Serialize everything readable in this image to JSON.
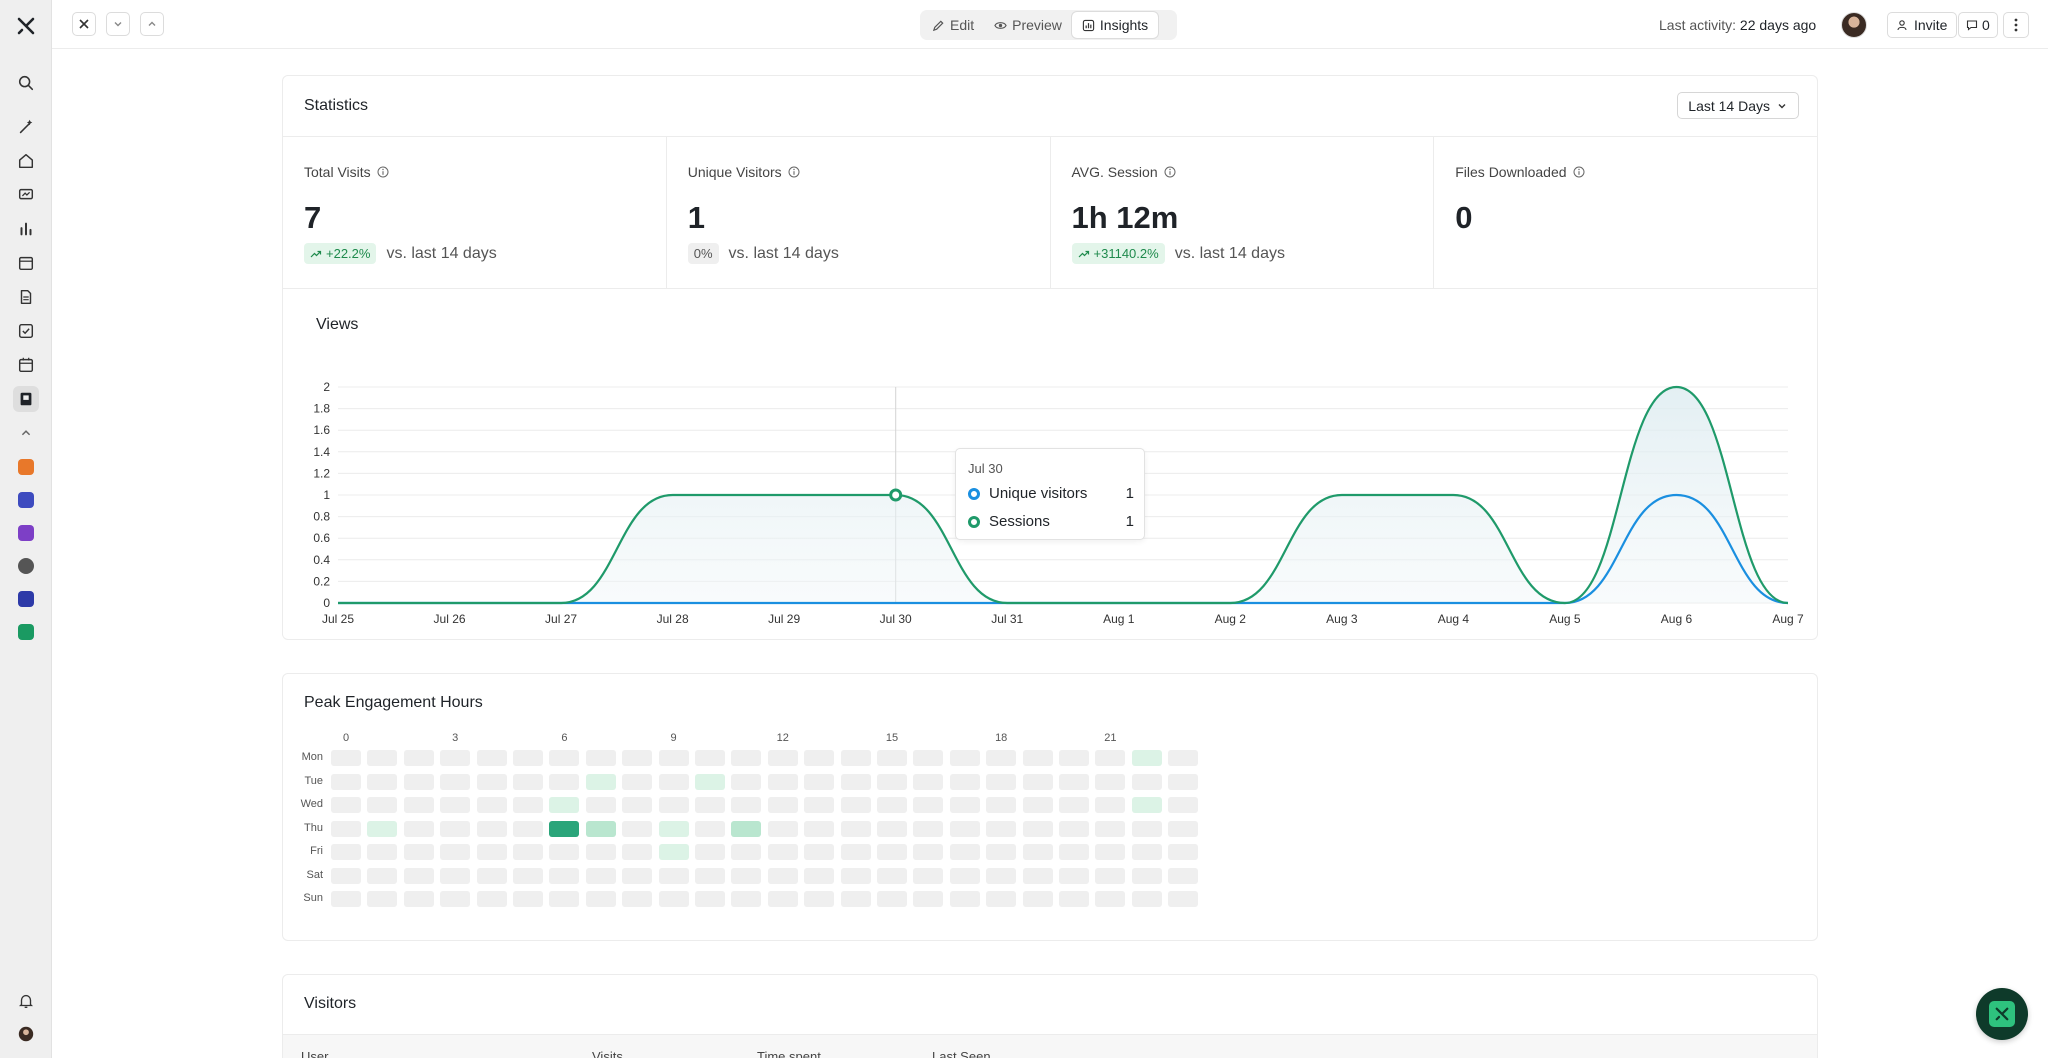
{
  "topbar": {
    "tabs": [
      {
        "label": "Edit",
        "icon": "pencil-icon"
      },
      {
        "label": "Preview",
        "icon": "eye-icon"
      },
      {
        "label": "Insights",
        "icon": "chart-icon",
        "active": true
      }
    ],
    "last_activity_label": "Last activity:",
    "last_activity_value": "22 days ago",
    "invite_label": "Invite",
    "comment_count": "0"
  },
  "statistics": {
    "title": "Statistics",
    "range_label": "Last 14 Days",
    "kpis": [
      {
        "label": "Total Visits",
        "value": "7",
        "change": "+22.2%",
        "trend": "up",
        "compare": "vs. last 14 days"
      },
      {
        "label": "Unique Visitors",
        "value": "1",
        "change": "0%",
        "trend": "neutral",
        "compare": "vs. last 14 days"
      },
      {
        "label": "AVG. Session",
        "value": "1h 12m",
        "change": "+31140.2%",
        "trend": "up",
        "compare": "vs. last 14 days"
      },
      {
        "label": "Files Downloaded",
        "value": "0",
        "change": "",
        "trend": "",
        "compare": ""
      }
    ]
  },
  "views": {
    "title": "Views",
    "tooltip": {
      "date": "Jul 30",
      "rows": [
        {
          "label": "Unique visitors",
          "value": "1",
          "color": "#1a8fe0"
        },
        {
          "label": "Sessions",
          "value": "1",
          "color": "#1f9a6a"
        }
      ]
    }
  },
  "chart_data": {
    "type": "area",
    "title": "Views",
    "x": [
      "Jul 25",
      "Jul 26",
      "Jul 27",
      "Jul 28",
      "Jul 29",
      "Jul 30",
      "Jul 31",
      "Aug 1",
      "Aug 2",
      "Aug 3",
      "Aug 4",
      "Aug 5",
      "Aug 6",
      "Aug 7"
    ],
    "y_ticks": [
      "0",
      "0.2",
      "0.4",
      "0.6",
      "0.8",
      "1",
      "1.2",
      "1.4",
      "1.6",
      "1.8",
      "2"
    ],
    "ylim": [
      0,
      2
    ],
    "grid": true,
    "series": [
      {
        "name": "Sessions",
        "color": "#1f9a6a",
        "values": [
          0,
          0,
          0,
          1,
          1,
          1,
          0,
          0,
          0,
          1,
          1,
          0,
          2,
          0
        ]
      },
      {
        "name": "Unique visitors",
        "color": "#1a8fe0",
        "values": [
          0,
          0,
          0,
          0,
          0,
          0,
          0,
          0,
          0,
          0,
          0,
          0,
          1,
          0
        ]
      }
    ],
    "highlight_x": "Jul 30"
  },
  "engagement": {
    "title": "Peak Engagement Hours",
    "hour_labels": [
      {
        "hour": 0,
        "label": "0"
      },
      {
        "hour": 3,
        "label": "3"
      },
      {
        "hour": 6,
        "label": "6"
      },
      {
        "hour": 9,
        "label": "9"
      },
      {
        "hour": 12,
        "label": "12"
      },
      {
        "hour": 15,
        "label": "15"
      },
      {
        "hour": 18,
        "label": "18"
      },
      {
        "hour": 21,
        "label": "21"
      }
    ],
    "days": [
      "Mon",
      "Tue",
      "Wed",
      "Thu",
      "Fri",
      "Sat",
      "Sun"
    ],
    "hours": 24,
    "levels": [
      [
        0,
        0,
        0,
        0,
        0,
        0,
        0,
        0,
        0,
        0,
        0,
        0,
        0,
        0,
        0,
        0,
        0,
        0,
        0,
        0,
        0,
        0,
        1,
        0
      ],
      [
        0,
        0,
        0,
        0,
        0,
        0,
        0,
        1,
        0,
        0,
        1,
        0,
        0,
        0,
        0,
        0,
        0,
        0,
        0,
        0,
        0,
        0,
        0,
        0
      ],
      [
        0,
        0,
        0,
        0,
        0,
        0,
        1,
        0,
        0,
        0,
        0,
        0,
        0,
        0,
        0,
        0,
        0,
        0,
        0,
        0,
        0,
        0,
        1,
        0
      ],
      [
        0,
        1,
        0,
        0,
        0,
        0,
        4,
        2,
        0,
        1,
        0,
        2,
        0,
        0,
        0,
        0,
        0,
        0,
        0,
        0,
        0,
        0,
        0,
        0
      ],
      [
        0,
        0,
        0,
        0,
        0,
        0,
        0,
        0,
        0,
        1,
        0,
        0,
        0,
        0,
        0,
        0,
        0,
        0,
        0,
        0,
        0,
        0,
        0,
        0
      ],
      [
        0,
        0,
        0,
        0,
        0,
        0,
        0,
        0,
        0,
        0,
        0,
        0,
        0,
        0,
        0,
        0,
        0,
        0,
        0,
        0,
        0,
        0,
        0,
        0
      ],
      [
        0,
        0,
        0,
        0,
        0,
        0,
        0,
        0,
        0,
        0,
        0,
        0,
        0,
        0,
        0,
        0,
        0,
        0,
        0,
        0,
        0,
        0,
        0,
        0
      ]
    ],
    "level_colors": [
      "#efefef",
      "#dcf3e6",
      "#b9e6cf",
      "#7fd0a8",
      "#2aa57a"
    ]
  },
  "visitors": {
    "title": "Visitors",
    "columns": [
      "User",
      "Visits",
      "Time spent",
      "Last Seen"
    ]
  },
  "colors": {
    "accent": "#1f9a6a",
    "secondary": "#1a8fe0"
  }
}
